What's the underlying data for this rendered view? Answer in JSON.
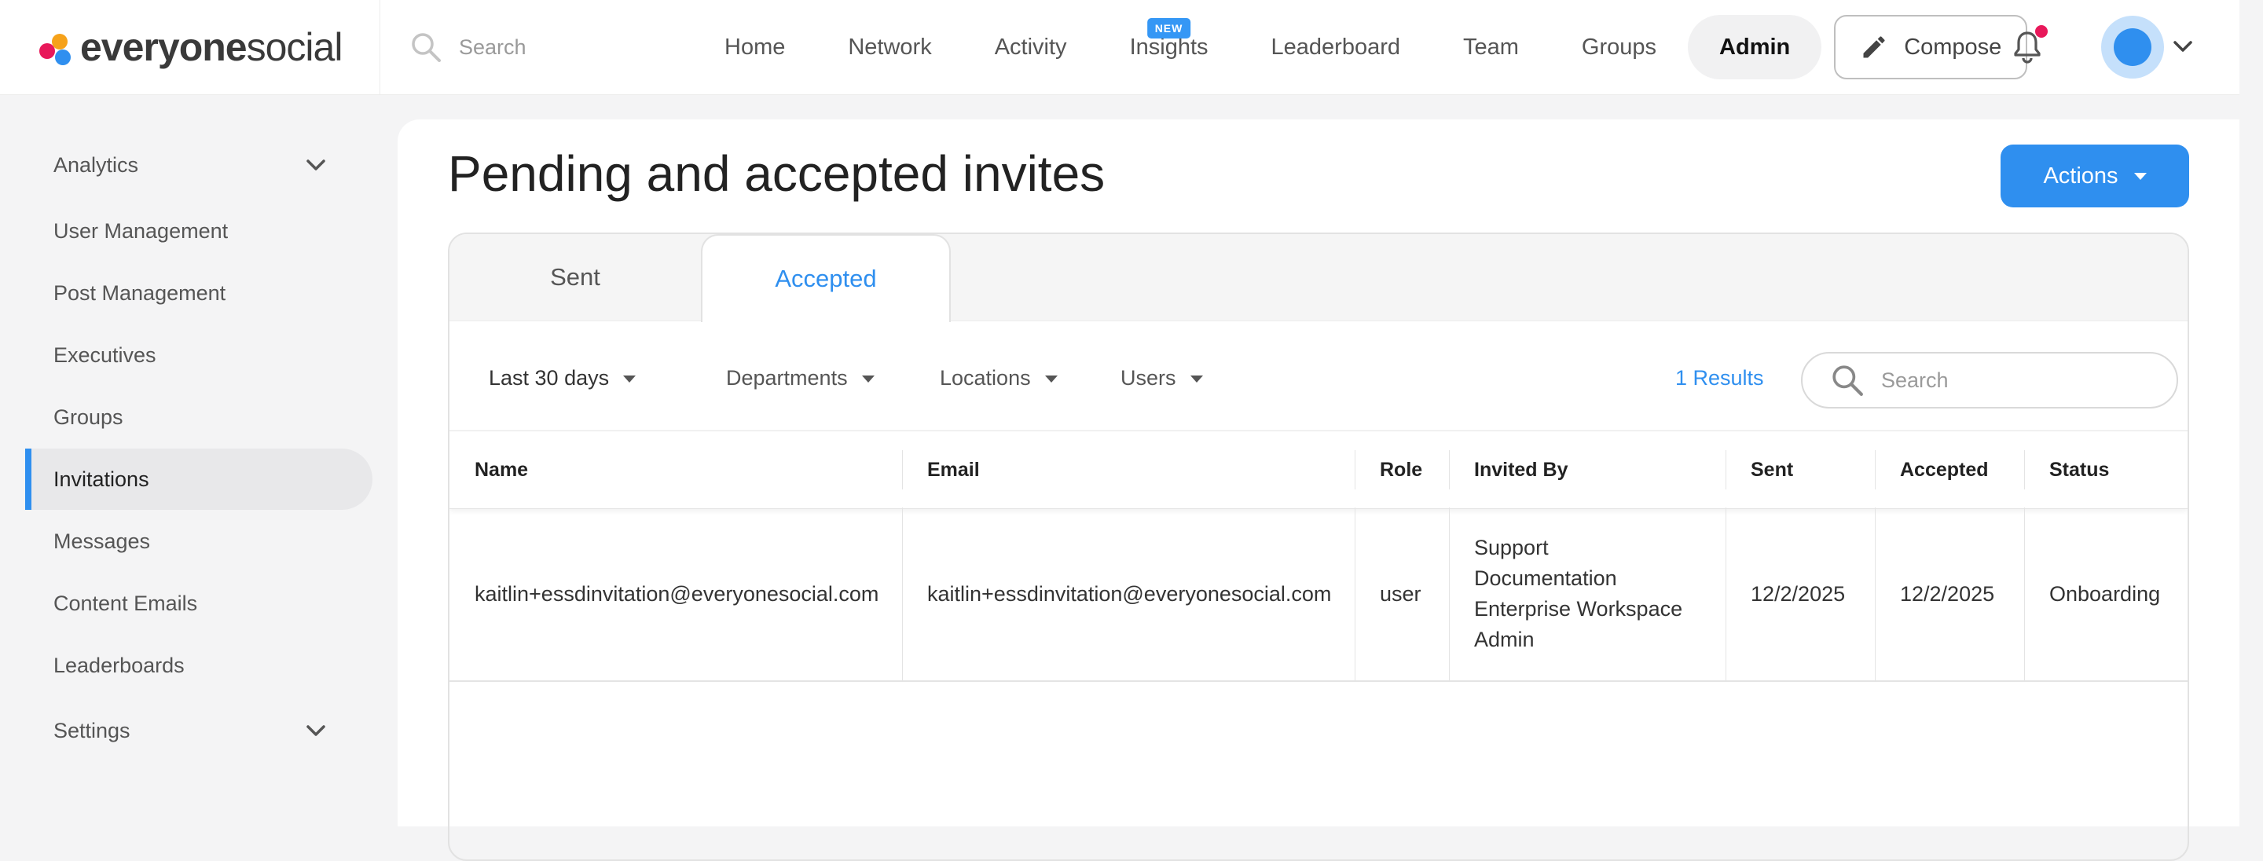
{
  "brand": {
    "name_part1": "everyone",
    "name_part2": "social"
  },
  "header": {
    "search_placeholder": "Search",
    "nav": [
      {
        "label": "Home"
      },
      {
        "label": "Network"
      },
      {
        "label": "Activity"
      },
      {
        "label": "Insights",
        "badge": "NEW"
      },
      {
        "label": "Leaderboard"
      },
      {
        "label": "Team"
      },
      {
        "label": "Groups"
      },
      {
        "label": "Admin",
        "active": true
      }
    ],
    "compose_label": "Compose",
    "has_notification": true
  },
  "sidebar": {
    "items": [
      {
        "label": "Analytics",
        "expandable": true
      },
      {
        "label": "User Management"
      },
      {
        "label": "Post Management"
      },
      {
        "label": "Executives"
      },
      {
        "label": "Groups"
      },
      {
        "label": "Invitations",
        "active": true
      },
      {
        "label": "Messages"
      },
      {
        "label": "Content Emails"
      },
      {
        "label": "Leaderboards"
      },
      {
        "label": "Settings",
        "expandable": true
      }
    ]
  },
  "main": {
    "title": "Pending and accepted invites",
    "actions_label": "Actions",
    "tabs": [
      {
        "label": "Sent"
      },
      {
        "label": "Accepted",
        "active": true
      }
    ],
    "filters": {
      "date_range": "Last 30 days",
      "departments": "Departments",
      "locations": "Locations",
      "users": "Users"
    },
    "results_count": "1 Results",
    "search_placeholder": "Search",
    "table": {
      "columns": [
        "Name",
        "Email",
        "Role",
        "Invited By",
        "Sent",
        "Accepted",
        "Status"
      ],
      "rows": [
        {
          "name": "kaitlin+essdinvitation@everyonesocial.com",
          "email": "kaitlin+essdinvitation@everyonesocial.com",
          "role": "user",
          "invited_by": [
            "Support",
            "Documentation",
            "Enterprise Workspace",
            "Admin"
          ],
          "sent": "12/2/2025",
          "accepted": "12/2/2025",
          "status": "Onboarding"
        }
      ]
    }
  },
  "colors": {
    "accent": "#2f8fef",
    "notification": "#e8185a",
    "logo_red": "#e8185a",
    "logo_orange": "#f6a21a",
    "logo_blue": "#2f8fef"
  }
}
